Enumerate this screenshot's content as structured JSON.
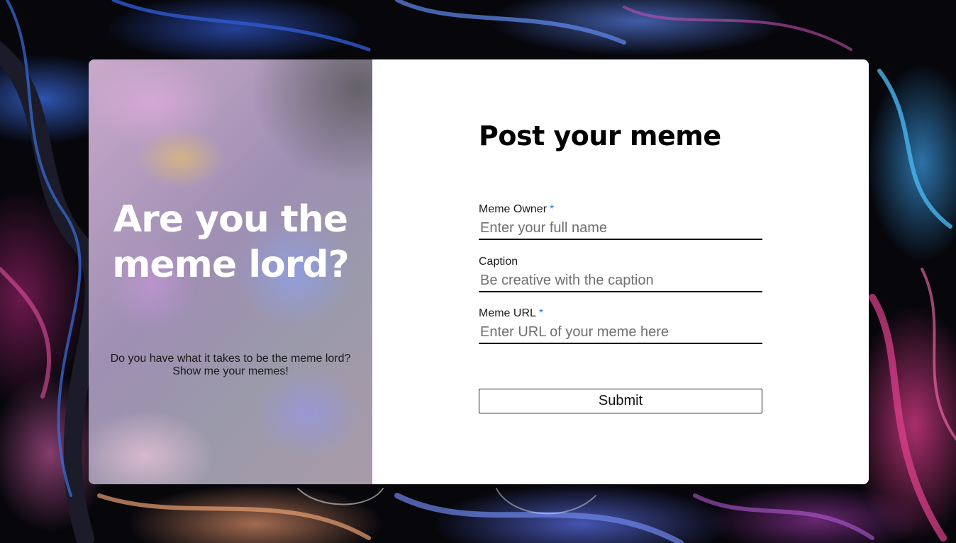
{
  "hero": {
    "title": "Are you the meme lord?",
    "subtitle": "Do you have what it takes to be the meme lord? Show me your memes!"
  },
  "form": {
    "title": "Post your meme",
    "fields": [
      {
        "label": "Meme Owner",
        "required_marker": "*",
        "placeholder": "Enter your full name",
        "value": ""
      },
      {
        "label": "Caption",
        "required_marker": "",
        "placeholder": "Be creative with the caption",
        "value": ""
      },
      {
        "label": "Meme URL",
        "required_marker": "*",
        "placeholder": "Enter URL of your meme here",
        "value": ""
      }
    ],
    "submit_label": "Submit"
  },
  "colors": {
    "required_marker": "#2a7de1",
    "card_background": "#ffffff",
    "hero_text": "#ffffff"
  }
}
